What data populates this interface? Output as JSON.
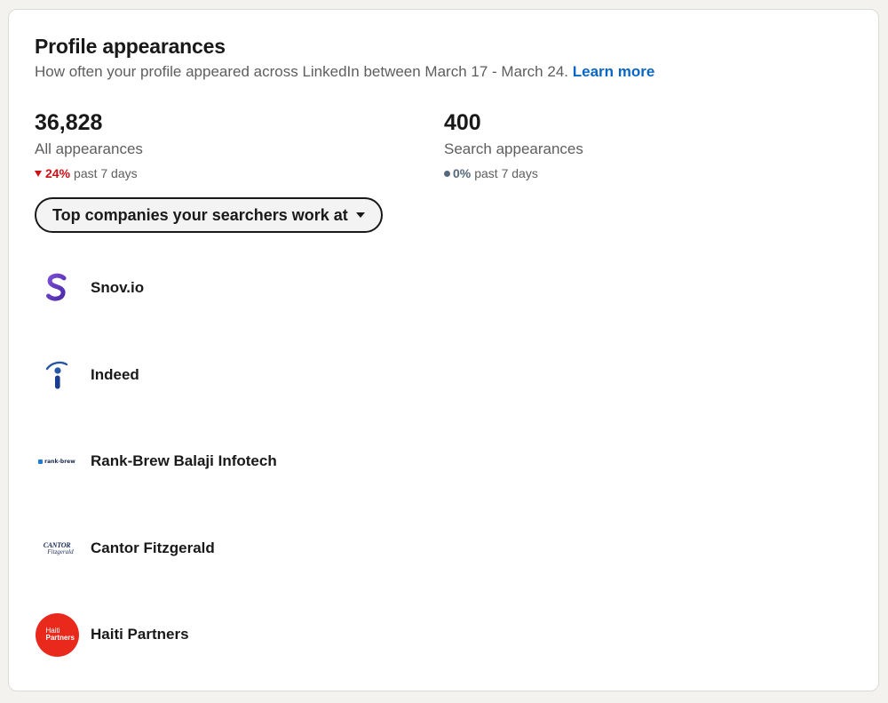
{
  "card": {
    "title": "Profile appearances",
    "subtitle": "How often your profile appeared across LinkedIn between March 17 - March 24.",
    "learn_more": "Learn more"
  },
  "stats": [
    {
      "value": "36,828",
      "label": "All appearances",
      "change": "24%",
      "change_direction": "down",
      "period": "past 7 days",
      "color": "#cc1016"
    },
    {
      "value": "400",
      "label": "Search appearances",
      "change": "0%",
      "change_direction": "neutral",
      "period": "past 7 days",
      "color": "#56687a"
    }
  ],
  "filter": {
    "label": "Top companies your searchers work at"
  },
  "companies": [
    {
      "name": "Snov.io",
      "logo": "snov-logo"
    },
    {
      "name": "Indeed",
      "logo": "indeed-logo"
    },
    {
      "name": "Rank-Brew Balaji Infotech",
      "logo": "rank-brew-logo",
      "logo_text": "rank-brew"
    },
    {
      "name": "Cantor Fitzgerald",
      "logo": "cantor-logo",
      "logo_text_top": "CANTOR",
      "logo_text_bottom": "Fitzgerald"
    },
    {
      "name": "Haiti Partners",
      "logo": "haiti-partners-logo",
      "logo_text_top": "Haiti",
      "logo_text_bottom": "Partners"
    }
  ],
  "colors": {
    "link": "#0a66c2",
    "negative": "#cc1016",
    "neutral": "#56687a",
    "haiti_red": "#e8291c"
  }
}
